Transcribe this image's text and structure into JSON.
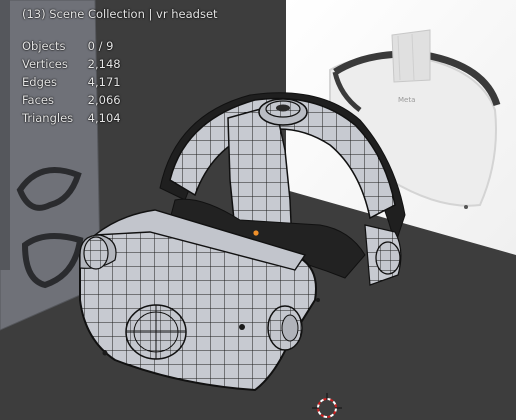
{
  "viewport": {
    "header": "(13) Scene Collection | vr headset",
    "stats": [
      {
        "label": "Objects",
        "value": "0 / 9"
      },
      {
        "label": "Vertices",
        "value": "2,148"
      },
      {
        "label": "Edges",
        "value": "4,171"
      },
      {
        "label": "Faces",
        "value": "2,066"
      },
      {
        "label": "Triangles",
        "value": "4,104"
      }
    ],
    "reference_logo_text": "Meta",
    "colors": {
      "background": "#3d3d3d",
      "mesh_face": "#c6c9d0",
      "mesh_wire": "#1a1a1a",
      "origin_dot": "#f0902a",
      "cursor_red": "#d02020"
    }
  }
}
